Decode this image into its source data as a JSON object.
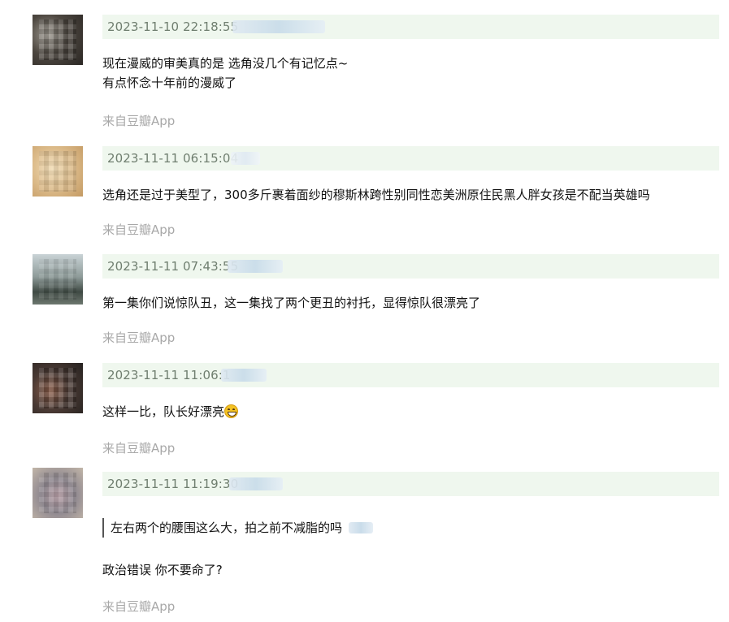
{
  "source_label": "来自豆瓣App",
  "comments": [
    {
      "timestamp": "2023-11-10 22:18:55",
      "lines": [
        "现在漫威的审美真的是 选角没几个有记忆点~",
        "有点怀念十年前的漫威了"
      ]
    },
    {
      "timestamp": "2023-11-11 06:15:04",
      "lines": [
        "选角还是过于美型了，300多斤裹着面纱的穆斯林跨性别同性恋美洲原住民黑人胖女孩是不配当英雄吗"
      ]
    },
    {
      "timestamp": "2023-11-11 07:43:55",
      "lines": [
        "第一集你们说惊队丑，这一集找了两个更丑的衬托，显得惊队很漂亮了"
      ]
    },
    {
      "timestamp": "2023-11-11 11:06:1",
      "lines": [
        "这样一比，队长好漂亮"
      ],
      "emoji": "grinning-sweat-emoji"
    },
    {
      "timestamp": "2023-11-11 11:19:30",
      "quote": "左右两个的腰围这么大，拍之前不减脂的吗",
      "lines": [
        "政治错误 你不要命了?"
      ]
    }
  ]
}
